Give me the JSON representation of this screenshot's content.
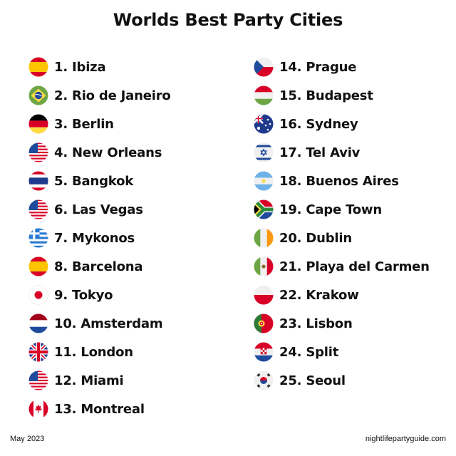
{
  "title": "Worlds Best Party Cities",
  "cities_left": [
    {
      "label": "1. Ibiza",
      "flag": "spain-flag-icon"
    },
    {
      "label": "2. Rio de Janeiro",
      "flag": "brazil-flag-icon"
    },
    {
      "label": "3. Berlin",
      "flag": "germany-flag-icon"
    },
    {
      "label": "4. New Orleans",
      "flag": "usa-flag-icon"
    },
    {
      "label": "5. Bangkok",
      "flag": "thailand-flag-icon"
    },
    {
      "label": "6. Las Vegas",
      "flag": "usa-flag-icon"
    },
    {
      "label": "7. Mykonos",
      "flag": "greece-flag-icon"
    },
    {
      "label": "8. Barcelona",
      "flag": "spain-flag-icon"
    },
    {
      "label": "9. Tokyo",
      "flag": "japan-flag-icon"
    },
    {
      "label": "10. Amsterdam",
      "flag": "netherlands-flag-icon"
    },
    {
      "label": "11. London",
      "flag": "uk-flag-icon"
    },
    {
      "label": "12. Miami",
      "flag": "usa-flag-icon"
    },
    {
      "label": "13. Montreal",
      "flag": "canada-flag-icon"
    }
  ],
  "cities_right": [
    {
      "label": "14. Prague",
      "flag": "czechia-flag-icon"
    },
    {
      "label": "15. Budapest",
      "flag": "hungary-flag-icon"
    },
    {
      "label": "16. Sydney",
      "flag": "australia-flag-icon"
    },
    {
      "label": "17. Tel Aviv",
      "flag": "israel-flag-icon"
    },
    {
      "label": "18. Buenos Aires",
      "flag": "argentina-flag-icon"
    },
    {
      "label": "19. Cape Town",
      "flag": "south-africa-flag-icon"
    },
    {
      "label": "20. Dublin",
      "flag": "ireland-flag-icon"
    },
    {
      "label": "21. Playa del Carmen",
      "flag": "mexico-flag-icon"
    },
    {
      "label": "22. Krakow",
      "flag": "poland-flag-icon"
    },
    {
      "label": "23. Lisbon",
      "flag": "portugal-flag-icon"
    },
    {
      "label": "24. Split",
      "flag": "croatia-flag-icon"
    },
    {
      "label": "25. Seoul",
      "flag": "south-korea-flag-icon"
    }
  ],
  "footer": {
    "date": "May 2023",
    "website": "nightlifepartyguide.com"
  }
}
